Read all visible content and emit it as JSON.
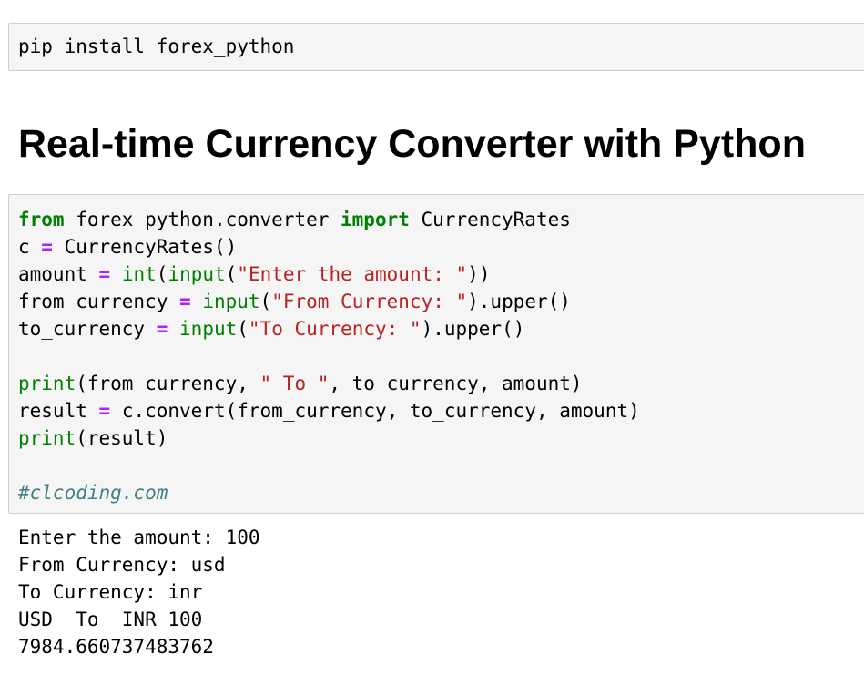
{
  "pip_cell": {
    "code": "pip install forex_python"
  },
  "heading": "Real-time Currency Converter with Python",
  "code_cell": {
    "lines": [
      [
        {
          "t": "from",
          "k": "kw"
        },
        {
          "t": " forex_python.converter ",
          "k": "plain"
        },
        {
          "t": "import",
          "k": "kw"
        },
        {
          "t": " CurrencyRates",
          "k": "plain"
        }
      ],
      [
        {
          "t": "c ",
          "k": "plain"
        },
        {
          "t": "=",
          "k": "op"
        },
        {
          "t": " CurrencyRates()",
          "k": "plain"
        }
      ],
      [
        {
          "t": "amount ",
          "k": "plain"
        },
        {
          "t": "=",
          "k": "op"
        },
        {
          "t": " ",
          "k": "plain"
        },
        {
          "t": "int",
          "k": "bi"
        },
        {
          "t": "(",
          "k": "plain"
        },
        {
          "t": "input",
          "k": "bi"
        },
        {
          "t": "(",
          "k": "plain"
        },
        {
          "t": "\"Enter the amount: \"",
          "k": "str"
        },
        {
          "t": "))",
          "k": "plain"
        }
      ],
      [
        {
          "t": "from_currency ",
          "k": "plain"
        },
        {
          "t": "=",
          "k": "op"
        },
        {
          "t": " ",
          "k": "plain"
        },
        {
          "t": "input",
          "k": "bi"
        },
        {
          "t": "(",
          "k": "plain"
        },
        {
          "t": "\"From Currency: \"",
          "k": "str"
        },
        {
          "t": ").upper()",
          "k": "plain"
        }
      ],
      [
        {
          "t": "to_currency ",
          "k": "plain"
        },
        {
          "t": "=",
          "k": "op"
        },
        {
          "t": " ",
          "k": "plain"
        },
        {
          "t": "input",
          "k": "bi"
        },
        {
          "t": "(",
          "k": "plain"
        },
        {
          "t": "\"To Currency: \"",
          "k": "str"
        },
        {
          "t": ").upper()",
          "k": "plain"
        }
      ],
      [],
      [
        {
          "t": "print",
          "k": "bi"
        },
        {
          "t": "(from_currency, ",
          "k": "plain"
        },
        {
          "t": "\" To \"",
          "k": "str"
        },
        {
          "t": ", to_currency, amount)",
          "k": "plain"
        }
      ],
      [
        {
          "t": "result ",
          "k": "plain"
        },
        {
          "t": "=",
          "k": "op"
        },
        {
          "t": " c.convert(from_currency, to_currency, amount)",
          "k": "plain"
        }
      ],
      [
        {
          "t": "print",
          "k": "bi"
        },
        {
          "t": "(result)",
          "k": "plain"
        }
      ],
      [],
      [
        {
          "t": "#clcoding.com",
          "k": "cm"
        }
      ]
    ]
  },
  "output_lines": [
    "Enter the amount: 100",
    "From Currency: usd",
    "To Currency: inr",
    "USD  To  INR 100",
    "7984.660737483762"
  ],
  "syntax_colors": {
    "keyword": "#008000",
    "operator": "#aa22ff",
    "builtin": "#008000",
    "string": "#ba2121",
    "comment": "#408080"
  }
}
